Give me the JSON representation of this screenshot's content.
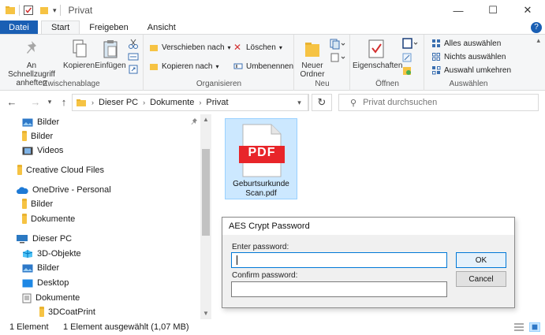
{
  "window": {
    "title": "Privat",
    "minimize": "—",
    "maximize": "☐",
    "close": "✕"
  },
  "tabs": [
    "Datei",
    "Start",
    "Freigeben",
    "Ansicht"
  ],
  "ribbon": {
    "zwischenablage": {
      "label": "Zwischenablage",
      "pin": "An Schnellzugriff anheften",
      "copy": "Kopieren",
      "paste": "Einfügen"
    },
    "organisieren": {
      "label": "Organisieren",
      "move": "Verschieben nach",
      "copy_to": "Kopieren nach",
      "delete": "Löschen",
      "rename": "Umbenennen"
    },
    "neu": {
      "label": "Neu",
      "new_folder": "Neuer Ordner"
    },
    "oeffnen": {
      "label": "Öffnen",
      "properties": "Eigenschaften"
    },
    "auswaehlen": {
      "label": "Auswählen",
      "select_all": "Alles auswählen",
      "select_none": "Nichts auswählen",
      "invert": "Auswahl umkehren"
    }
  },
  "address": {
    "segments": [
      "Dieser PC",
      "Dokumente",
      "Privat"
    ],
    "search_placeholder": "Privat durchsuchen"
  },
  "navpane": {
    "items": [
      {
        "label": "Bilder",
        "icon": "pictures-icon"
      },
      {
        "label": "Bilder",
        "icon": "folder-icon"
      },
      {
        "label": "Videos",
        "icon": "videos-icon"
      },
      {
        "label": "Creative Cloud Files",
        "icon": "folder-icon"
      },
      {
        "label": "OneDrive - Personal",
        "icon": "cloud-icon"
      },
      {
        "label": "Bilder",
        "icon": "folder-icon"
      },
      {
        "label": "Dokumente",
        "icon": "folder-icon"
      },
      {
        "label": "Dieser PC",
        "icon": "computer-icon"
      },
      {
        "label": "3D-Objekte",
        "icon": "3d-objects-icon"
      },
      {
        "label": "Bilder",
        "icon": "pictures-icon"
      },
      {
        "label": "Desktop",
        "icon": "desktop-icon"
      },
      {
        "label": "Dokumente",
        "icon": "documents-icon"
      },
      {
        "label": "3DCoatPrint",
        "icon": "folder-icon"
      }
    ]
  },
  "file": {
    "name_line1": "Geburtsurkunde",
    "name_line2": "Scan.pdf",
    "badge": "PDF"
  },
  "dialog": {
    "title": "AES Crypt Password",
    "enter_label": "Enter password:",
    "confirm_label": "Confirm password:",
    "ok": "OK",
    "cancel": "Cancel"
  },
  "status": {
    "count": "1 Element",
    "selected": "1 Element ausgewählt (1,07 MB)"
  },
  "colors": {
    "accent": "#1a5fb4",
    "selection": "#cce8ff",
    "pdf_red": "#e8252a",
    "folder": "#f6c343"
  }
}
